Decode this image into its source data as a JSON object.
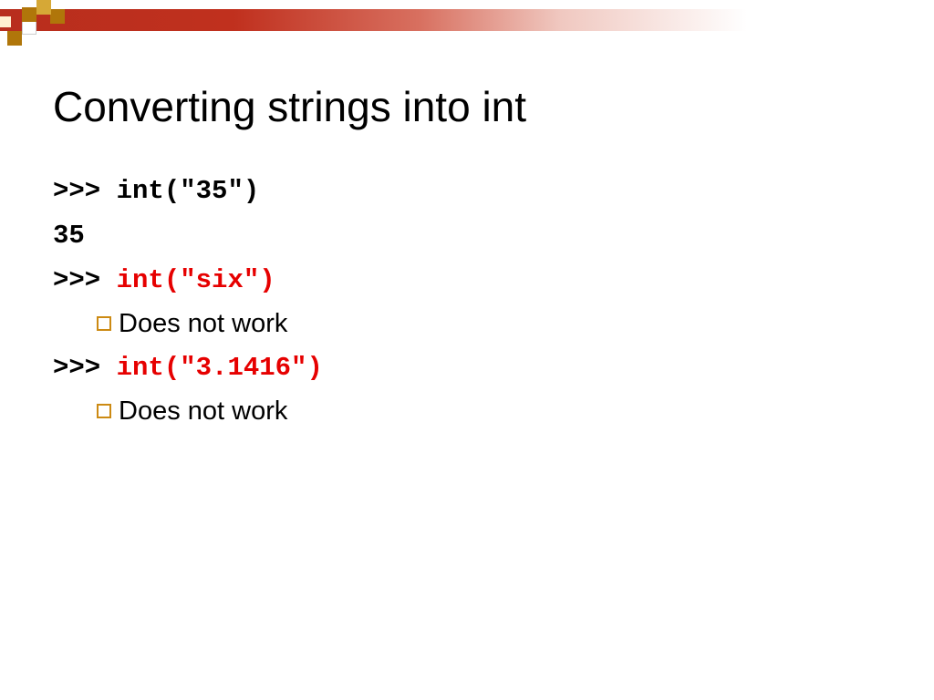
{
  "title": "Converting strings into int",
  "lines": {
    "l1_prompt": ">>>",
    "l1_code": " int(\"35\")",
    "l2_output": "35",
    "l3_prompt": ">>>",
    "l3_code": "int(\"six\")",
    "l4_bullet": "Does not work",
    "l5_prompt": ">>>",
    "l5_code": "int(\"3.1416\")",
    "l6_bullet": "Does not work"
  },
  "colors": {
    "error_red": "#e60000",
    "bullet_border": "#cc8a13",
    "gradient_start": "#b82e1d"
  }
}
